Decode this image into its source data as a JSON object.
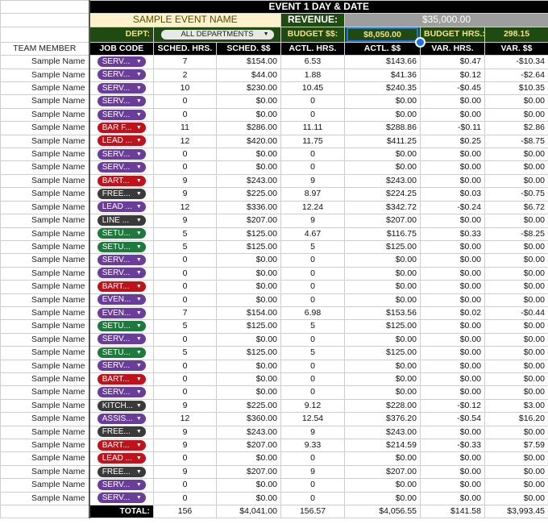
{
  "title": "EVENT 1 DAY & DATE",
  "event_name": "SAMPLE EVENT NAME",
  "revenue_label": "REVENUE:",
  "revenue_value": "$35,000.00",
  "dept_label": "DEPT:",
  "dept_value": "ALL DEPARTMENTS",
  "budget_label": "BUDGET $$:",
  "budget_value": "$8,050.00",
  "budget_hrs_label": "BUDGET HRS.:",
  "budget_hrs_value": "298.15",
  "headers": {
    "team_member": "TEAM MEMBER",
    "job_code": "JOB CODE",
    "sched_hrs": "SCHED. HRS.",
    "sched_dollars": "SCHED. $$",
    "actl_hrs": "ACTL. HRS.",
    "actl_dollars": "ACTL. $$",
    "var_hrs": "VAR. HRS.",
    "var_dollars": "VAR. $$"
  },
  "colors": {
    "purple": "#6a3d9a",
    "red": "#c0121b",
    "dark": "#3a3a3a",
    "green": "#1e7a3c"
  },
  "rows": [
    {
      "name": "Sample Name",
      "job": "SERV...",
      "color": "purple",
      "sh": "7",
      "sd": "$154.00",
      "ah": "6.53",
      "ad": "$143.66",
      "vh": "$0.47",
      "vd": "-$10.34"
    },
    {
      "name": "Sample Name",
      "job": "SERV...",
      "color": "purple",
      "sh": "2",
      "sd": "$44.00",
      "ah": "1.88",
      "ad": "$41.36",
      "vh": "$0.12",
      "vd": "-$2.64"
    },
    {
      "name": "Sample Name",
      "job": "SERV...",
      "color": "purple",
      "sh": "10",
      "sd": "$230.00",
      "ah": "10.45",
      "ad": "$240.35",
      "vh": "-$0.45",
      "vd": "$10.35"
    },
    {
      "name": "Sample Name",
      "job": "SERV...",
      "color": "purple",
      "sh": "0",
      "sd": "$0.00",
      "ah": "0",
      "ad": "$0.00",
      "vh": "$0.00",
      "vd": "$0.00"
    },
    {
      "name": "Sample Name",
      "job": "SERV...",
      "color": "purple",
      "sh": "0",
      "sd": "$0.00",
      "ah": "0",
      "ad": "$0.00",
      "vh": "$0.00",
      "vd": "$0.00"
    },
    {
      "name": "Sample Name",
      "job": "BAR F...",
      "color": "red",
      "sh": "11",
      "sd": "$286.00",
      "ah": "11.11",
      "ad": "$288.86",
      "vh": "-$0.11",
      "vd": "$2.86"
    },
    {
      "name": "Sample Name",
      "job": "LEAD ...",
      "color": "red",
      "sh": "12",
      "sd": "$420.00",
      "ah": "11.75",
      "ad": "$411.25",
      "vh": "$0.25",
      "vd": "-$8.75"
    },
    {
      "name": "Sample Name",
      "job": "SERV...",
      "color": "purple",
      "sh": "0",
      "sd": "$0.00",
      "ah": "0",
      "ad": "$0.00",
      "vh": "$0.00",
      "vd": "$0.00"
    },
    {
      "name": "Sample Name",
      "job": "SERV...",
      "color": "purple",
      "sh": "0",
      "sd": "$0.00",
      "ah": "0",
      "ad": "$0.00",
      "vh": "$0.00",
      "vd": "$0.00"
    },
    {
      "name": "Sample Name",
      "job": "BART...",
      "color": "red",
      "sh": "9",
      "sd": "$243.00",
      "ah": "9",
      "ad": "$243.00",
      "vh": "$0.00",
      "vd": "$0.00"
    },
    {
      "name": "Sample Name",
      "job": "FREE...",
      "color": "dark",
      "sh": "9",
      "sd": "$225.00",
      "ah": "8.97",
      "ad": "$224.25",
      "vh": "$0.03",
      "vd": "-$0.75"
    },
    {
      "name": "Sample Name",
      "job": "LEAD ...",
      "color": "purple",
      "sh": "12",
      "sd": "$336.00",
      "ah": "12.24",
      "ad": "$342.72",
      "vh": "-$0.24",
      "vd": "$6.72"
    },
    {
      "name": "Sample Name",
      "job": "LINE ...",
      "color": "dark",
      "sh": "9",
      "sd": "$207.00",
      "ah": "9",
      "ad": "$207.00",
      "vh": "$0.00",
      "vd": "$0.00"
    },
    {
      "name": "Sample Name",
      "job": "SETU...",
      "color": "green",
      "sh": "5",
      "sd": "$125.00",
      "ah": "4.67",
      "ad": "$116.75",
      "vh": "$0.33",
      "vd": "-$8.25"
    },
    {
      "name": "Sample Name",
      "job": "SETU...",
      "color": "green",
      "sh": "5",
      "sd": "$125.00",
      "ah": "5",
      "ad": "$125.00",
      "vh": "$0.00",
      "vd": "$0.00"
    },
    {
      "name": "Sample Name",
      "job": "SERV...",
      "color": "purple",
      "sh": "0",
      "sd": "$0.00",
      "ah": "0",
      "ad": "$0.00",
      "vh": "$0.00",
      "vd": "$0.00"
    },
    {
      "name": "Sample Name",
      "job": "SERV...",
      "color": "purple",
      "sh": "0",
      "sd": "$0.00",
      "ah": "0",
      "ad": "$0.00",
      "vh": "$0.00",
      "vd": "$0.00"
    },
    {
      "name": "Sample Name",
      "job": "BART...",
      "color": "red",
      "sh": "0",
      "sd": "$0.00",
      "ah": "0",
      "ad": "$0.00",
      "vh": "$0.00",
      "vd": "$0.00"
    },
    {
      "name": "Sample Name",
      "job": "EVEN...",
      "color": "purple",
      "sh": "0",
      "sd": "$0.00",
      "ah": "0",
      "ad": "$0.00",
      "vh": "$0.00",
      "vd": "$0.00"
    },
    {
      "name": "Sample Name",
      "job": "EVEN...",
      "color": "purple",
      "sh": "7",
      "sd": "$154.00",
      "ah": "6.98",
      "ad": "$153.56",
      "vh": "$0.02",
      "vd": "-$0.44"
    },
    {
      "name": "Sample Name",
      "job": "SETU...",
      "color": "green",
      "sh": "5",
      "sd": "$125.00",
      "ah": "5",
      "ad": "$125.00",
      "vh": "$0.00",
      "vd": "$0.00"
    },
    {
      "name": "Sample Name",
      "job": "SERV...",
      "color": "purple",
      "sh": "0",
      "sd": "$0.00",
      "ah": "0",
      "ad": "$0.00",
      "vh": "$0.00",
      "vd": "$0.00"
    },
    {
      "name": "Sample Name",
      "job": "SETU...",
      "color": "green",
      "sh": "5",
      "sd": "$125.00",
      "ah": "5",
      "ad": "$125.00",
      "vh": "$0.00",
      "vd": "$0.00"
    },
    {
      "name": "Sample Name",
      "job": "SERV...",
      "color": "purple",
      "sh": "0",
      "sd": "$0.00",
      "ah": "0",
      "ad": "$0.00",
      "vh": "$0.00",
      "vd": "$0.00"
    },
    {
      "name": "Sample Name",
      "job": "BART...",
      "color": "red",
      "sh": "0",
      "sd": "$0.00",
      "ah": "0",
      "ad": "$0.00",
      "vh": "$0.00",
      "vd": "$0.00"
    },
    {
      "name": "Sample Name",
      "job": "SERV...",
      "color": "purple",
      "sh": "0",
      "sd": "$0.00",
      "ah": "0",
      "ad": "$0.00",
      "vh": "$0.00",
      "vd": "$0.00"
    },
    {
      "name": "Sample Name",
      "job": "KITCH...",
      "color": "dark",
      "sh": "9",
      "sd": "$225.00",
      "ah": "9.12",
      "ad": "$228.00",
      "vh": "-$0.12",
      "vd": "$3.00"
    },
    {
      "name": "Sample Name",
      "job": "ASSIS...",
      "color": "purple",
      "sh": "12",
      "sd": "$360.00",
      "ah": "12.54",
      "ad": "$376.20",
      "vh": "-$0.54",
      "vd": "$16.20"
    },
    {
      "name": "Sample Name",
      "job": "FREE...",
      "color": "dark",
      "sh": "9",
      "sd": "$243.00",
      "ah": "9",
      "ad": "$243.00",
      "vh": "$0.00",
      "vd": "$0.00"
    },
    {
      "name": "Sample Name",
      "job": "BART...",
      "color": "red",
      "sh": "9",
      "sd": "$207.00",
      "ah": "9.33",
      "ad": "$214.59",
      "vh": "-$0.33",
      "vd": "$7.59"
    },
    {
      "name": "Sample Name",
      "job": "LEAD ...",
      "color": "red",
      "sh": "0",
      "sd": "$0.00",
      "ah": "0",
      "ad": "$0.00",
      "vh": "$0.00",
      "vd": "$0.00"
    },
    {
      "name": "Sample Name",
      "job": "FREE...",
      "color": "dark",
      "sh": "9",
      "sd": "$207.00",
      "ah": "9",
      "ad": "$207.00",
      "vh": "$0.00",
      "vd": "$0.00"
    },
    {
      "name": "Sample Name",
      "job": "SERV...",
      "color": "purple",
      "sh": "0",
      "sd": "$0.00",
      "ah": "0",
      "ad": "$0.00",
      "vh": "$0.00",
      "vd": "$0.00"
    },
    {
      "name": "Sample Name",
      "job": "SERV...",
      "color": "purple",
      "sh": "0",
      "sd": "$0.00",
      "ah": "0",
      "ad": "$0.00",
      "vh": "$0.00",
      "vd": "$0.00"
    }
  ],
  "totals": {
    "label": "TOTAL:",
    "sh": "156",
    "sd": "$4,041.00",
    "ah": "156.57",
    "ad": "$4,056.55",
    "vh": "$141.58",
    "vd": "$3,993.45"
  }
}
